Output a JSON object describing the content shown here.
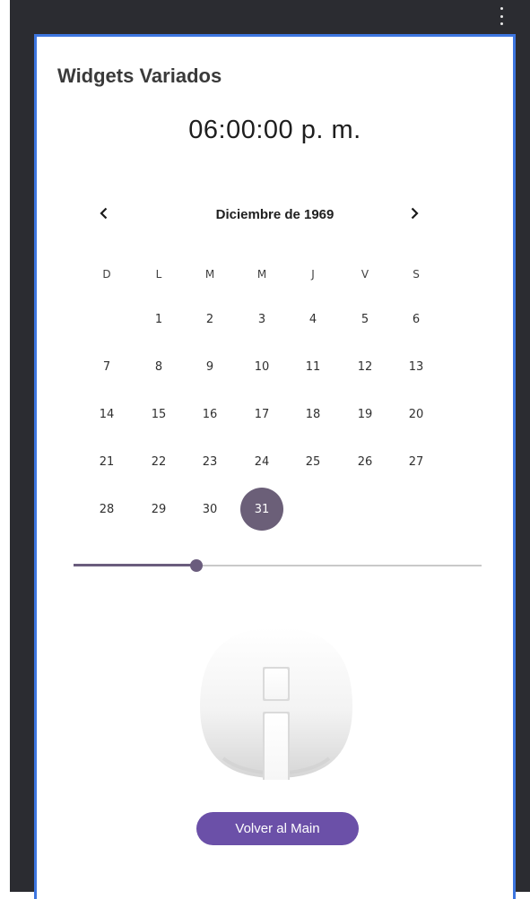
{
  "toolbar": {
    "overflow_icon": "more-vert-icon"
  },
  "screen": {
    "title": "Widgets Variados"
  },
  "clock": {
    "time": "06:00:00 p. m."
  },
  "calendar": {
    "header": "Diciembre de 1969",
    "prev_icon": "chevron-left-icon",
    "next_icon": "chevron-right-icon",
    "weekdays": [
      "D",
      "L",
      "M",
      "M",
      "J",
      "V",
      "S"
    ],
    "weeks": [
      [
        "",
        "1",
        "2",
        "3",
        "4",
        "5",
        "6"
      ],
      [
        "7",
        "8",
        "9",
        "10",
        "11",
        "12",
        "13"
      ],
      [
        "14",
        "15",
        "16",
        "17",
        "18",
        "19",
        "20"
      ],
      [
        "21",
        "22",
        "23",
        "24",
        "25",
        "26",
        "27"
      ],
      [
        "28",
        "29",
        "30",
        "31",
        "",
        "",
        ""
      ]
    ],
    "selected_day": "31",
    "selected_color": "#6b5f78"
  },
  "slider": {
    "value_fraction": 0.3,
    "color": "#6a5c7d"
  },
  "image": {
    "icon": "info-icon"
  },
  "button": {
    "label": "Volver al Main",
    "color": "#6b50a8"
  }
}
